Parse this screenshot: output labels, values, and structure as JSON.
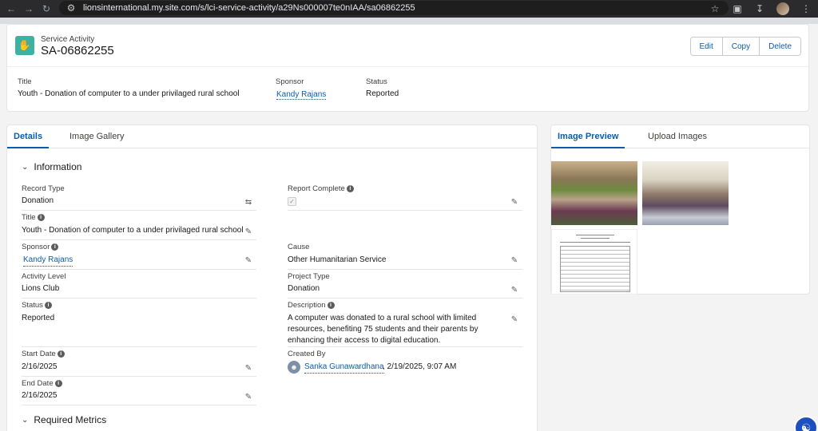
{
  "browser": {
    "url": "lionsinternational.my.site.com/s/lci-service-activity/a29Ns000007te0nIAA/sa06862255"
  },
  "header": {
    "object_label": "Service Activity",
    "record_name": "SA-06862255",
    "actions": [
      "Edit",
      "Copy",
      "Delete"
    ],
    "highlights": {
      "title_label": "Title",
      "title_value": "Youth - Donation of computer to a under privilaged rural school",
      "sponsor_label": "Sponsor",
      "sponsor_value": "Kandy Rajans",
      "status_label": "Status",
      "status_value": "Reported"
    }
  },
  "details": {
    "tabs": [
      "Details",
      "Image Gallery"
    ],
    "section_information": "Information",
    "section_metrics": "Required Metrics",
    "fields": {
      "record_type_label": "Record Type",
      "record_type_value": "Donation",
      "report_complete_label": "Report Complete",
      "title_label": "Title",
      "title_value": "Youth - Donation of computer to a under privilaged rural school",
      "sponsor_label": "Sponsor",
      "sponsor_value": "Kandy Rajans",
      "cause_label": "Cause",
      "cause_value": "Other Humanitarian Service",
      "activity_level_label": "Activity Level",
      "activity_level_value": "Lions Club",
      "project_type_label": "Project Type",
      "project_type_value": "Donation",
      "status_label": "Status",
      "status_value": "Reported",
      "description_label": "Description",
      "description_line1": "A computer was donated to a rural school with limited",
      "description_line2": "resources, benefiting 75 students and their parents by",
      "description_line3": "enhancing their access to digital education.",
      "start_date_label": "Start Date",
      "start_date_value": "2/16/2025",
      "created_by_label": "Created By",
      "created_by_user": "Sanka Gunawardhana",
      "created_by_date": ", 2/19/2025, 9:07 AM",
      "end_date_label": "End Date",
      "end_date_value": "2/16/2025"
    }
  },
  "images": {
    "tabs": [
      "Image Preview",
      "Upload Images"
    ]
  },
  "colors": {
    "brand_blue": "#0b5cab",
    "service_icon": "#3fb1a3"
  }
}
